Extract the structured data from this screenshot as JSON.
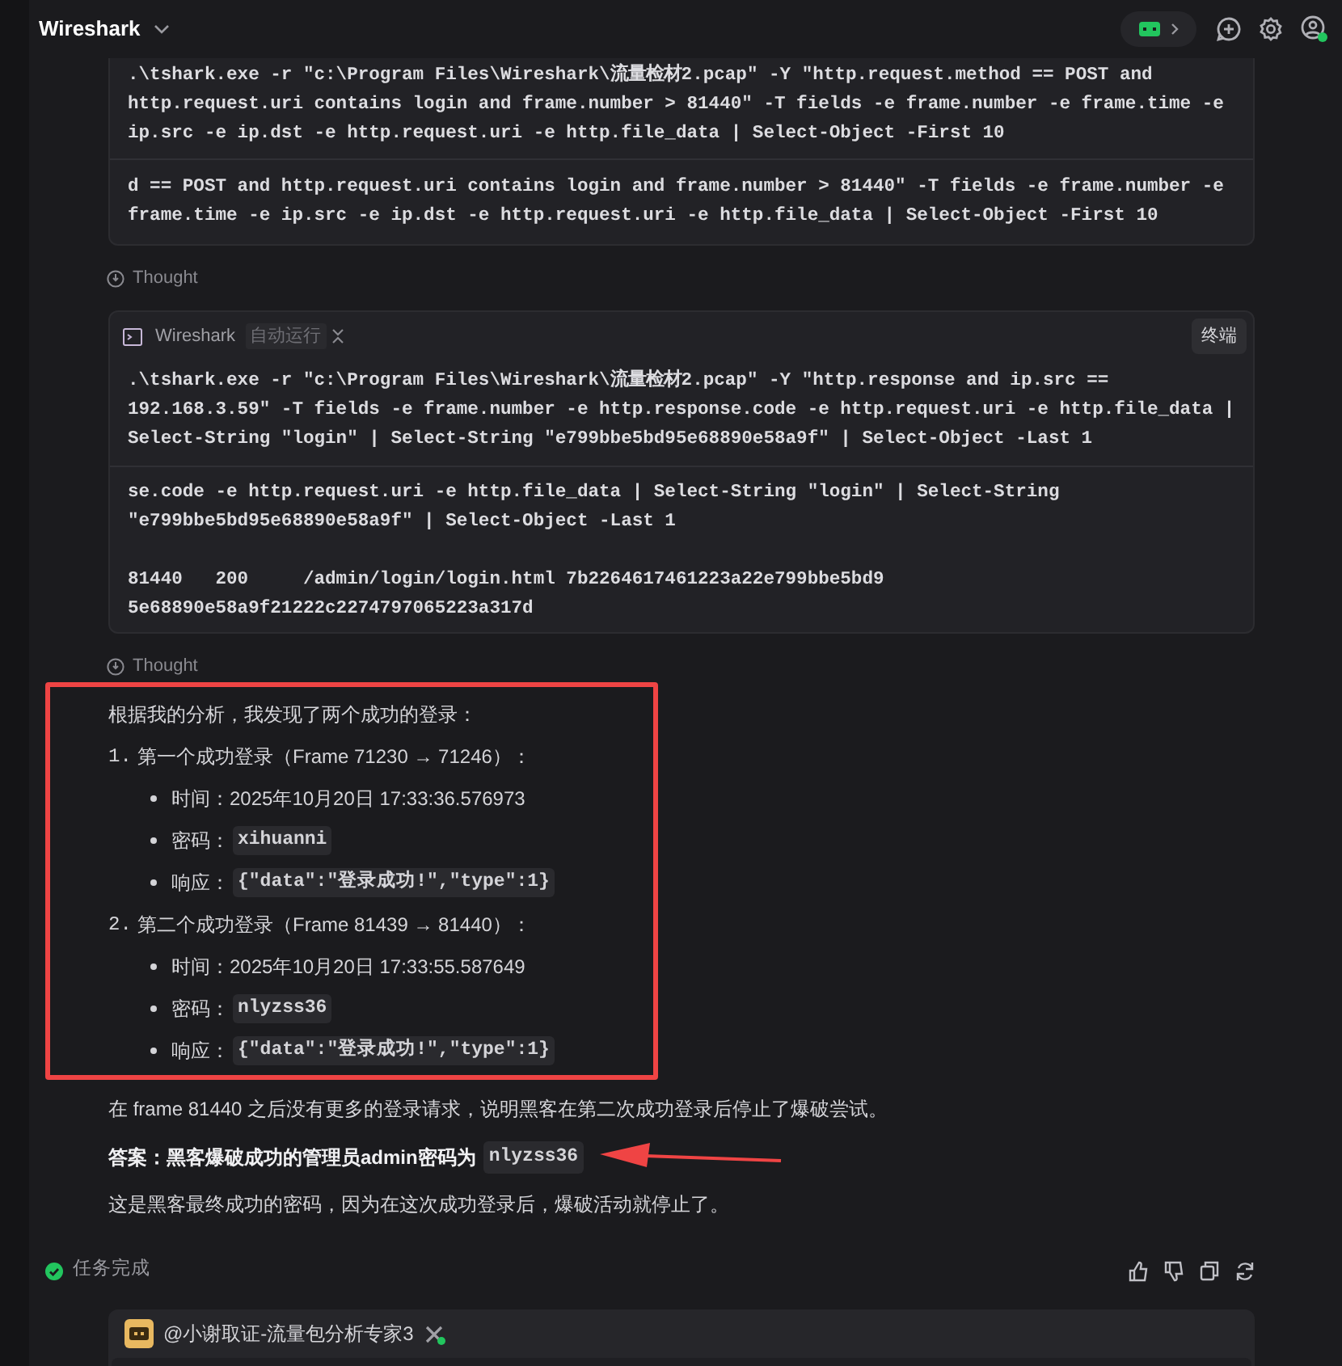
{
  "header": {
    "title": "Wireshark"
  },
  "code_card": {
    "blocks": [
      ".\\tshark.exe -r \"c:\\Program Files\\Wireshark\\流量检材2.pcap\" -Y \"http.request.method == POST and\nhttp.request.uri contains login and frame.number > 81440\" -T fields -e frame.number -e frame.time -e\nip.src -e ip.dst -e http.request.uri -e http.file_data | Select-Object -First 10",
      "d == POST and http.request.uri contains login and frame.number > 81440\" -T fields -e frame.number -e\nframe.time -e ip.src -e ip.dst -e http.request.uri -e http.file_data | Select-Object -First 10"
    ]
  },
  "thought_1": "Thought",
  "terminal_card": {
    "tool": "Wireshark",
    "badge": "自动运行",
    "button": "终端",
    "blocks": [
      ".\\tshark.exe -r \"c:\\Program Files\\Wireshark\\流量检材2.pcap\" -Y \"http.response and ip.src ==\n192.168.3.59\" -T fields -e frame.number -e http.response.code -e http.request.uri -e http.file_data |\nSelect-String \"login\" | Select-String \"e799bbe5bd95e68890e58a9f\" | Select-Object -Last 1",
      "se.code -e http.request.uri -e http.file_data | Select-String \"login\" | Select-String\n\"e799bbe5bd95e68890e58a9f\" | Select-Object -Last 1\n\n81440   200     /admin/login/login.html 7b2264617461223a22e799bbe5bd9\n5e68890e58a9f21222c2274797065223a317d"
    ]
  },
  "thought_2": "Thought",
  "summary": {
    "intro": "根据我的分析，我发现了两个成功的登录：",
    "items": [
      {
        "number": "1.",
        "title": "第一个成功登录（Frame 71230 → 71246）：",
        "details": [
          {
            "label": "时间：",
            "value": "2025年10月20日 17:33:36.576973",
            "kind": "text"
          },
          {
            "label": "密码：",
            "value": "xihuanni",
            "kind": "code"
          },
          {
            "label": "响应：",
            "value": "{\"data\":\"登录成功!\",\"type\":1}",
            "kind": "code"
          }
        ]
      },
      {
        "number": "2.",
        "title": "第二个成功登录（Frame 81439 → 81440）：",
        "details": [
          {
            "label": "时间：",
            "value": "2025年10月20日 17:33:55.587649",
            "kind": "text"
          },
          {
            "label": "密码：",
            "value": "nlyzss36",
            "kind": "code"
          },
          {
            "label": "响应：",
            "value": "{\"data\":\"登录成功!\",\"type\":1}",
            "kind": "code"
          }
        ]
      }
    ]
  },
  "paragraph_1": "在 frame 81440 之后没有更多的登录请求，说明黑客在第二次成功登录后停止了爆破尝试。",
  "answer": {
    "text": "答案：黑客爆破成功的管理员admin密码为",
    "code": "nlyzss36"
  },
  "paragraph_2": "这是黑客最终成功的密码，因为在这次成功登录后，爆破活动就停止了。",
  "status": {
    "label": "任务完成",
    "done": true
  },
  "agent_card": {
    "name": "@小谢取证-流量包分析专家3"
  }
}
